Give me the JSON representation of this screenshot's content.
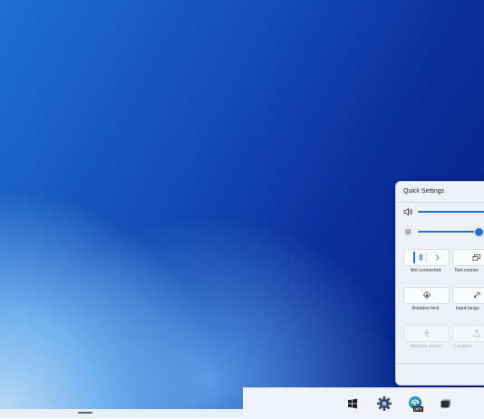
{
  "quick_settings": {
    "title": "Quick Settings",
    "volume_level": 1.0,
    "brightness_level": 0.8,
    "tiles": [
      {
        "id": "bluetooth",
        "label": "Not connected",
        "icon": "bluetooth-icon",
        "enabled": true
      },
      {
        "id": "cast",
        "label": "Not connec",
        "icon": "cast-icon",
        "enabled": true
      },
      {
        "id": "rotation",
        "label": "Rotation lock",
        "icon": "rotation-lock-icon",
        "enabled": true
      },
      {
        "id": "input",
        "label": "Input langu",
        "icon": "input-language-icon",
        "enabled": true
      },
      {
        "id": "airplane",
        "label": "Airplane mode",
        "icon": "airplane-icon",
        "enabled": false
      },
      {
        "id": "location",
        "label": "Location",
        "icon": "location-icon",
        "enabled": false
      }
    ]
  },
  "taskbar": {
    "icons": [
      "start-icon",
      "settings-icon",
      "edge-dev-icon",
      "task-view-icon"
    ],
    "edge_badge": "DEV"
  },
  "colors": {
    "accent": "#1a6fd8",
    "panel_bg": "#eef1f8",
    "taskbar_bg": "#f1f3f8"
  }
}
